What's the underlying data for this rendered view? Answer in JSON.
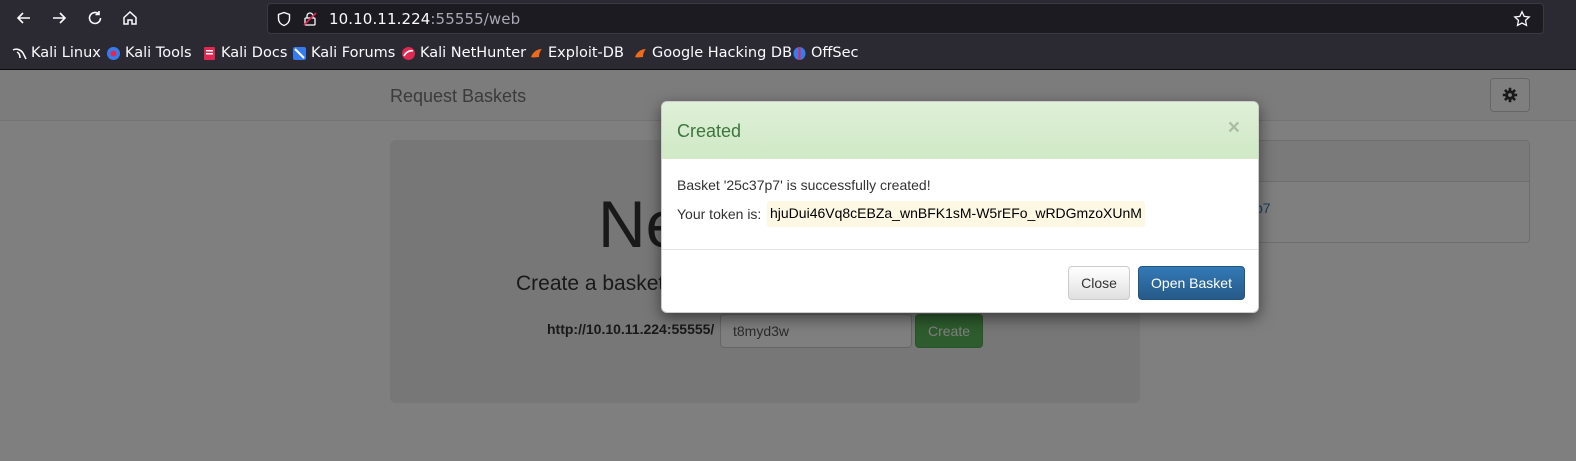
{
  "browser": {
    "url_host": "10.10.11.224",
    "url_rest": ":55555/web",
    "bookmarks": [
      {
        "label": "Kali Linux",
        "icon": "kali-dragon-icon"
      },
      {
        "label": "Kali Tools",
        "icon": "kali-tools-icon"
      },
      {
        "label": "Kali Docs",
        "icon": "kali-docs-icon"
      },
      {
        "label": "Kali Forums",
        "icon": "kali-forums-icon"
      },
      {
        "label": "Kali NetHunter",
        "icon": "kali-nethunter-icon"
      },
      {
        "label": "Exploit-DB",
        "icon": "exploit-db-icon"
      },
      {
        "label": "Google Hacking DB",
        "icon": "ghdb-icon"
      },
      {
        "label": "OffSec",
        "icon": "offsec-icon"
      }
    ]
  },
  "page": {
    "brand": "Request Baskets",
    "jumbo_title": "Ne",
    "jumbo_lead": "Create a basket",
    "url_prefix": "http://10.10.11.224:55555/",
    "basket_name_value": "t8myd3w",
    "create_label": "Create",
    "side_heading": ":",
    "side_link": "p7"
  },
  "modal": {
    "title": "Created",
    "close_x": "×",
    "message": "Basket '25c37p7' is successfully created!",
    "token_label": "Your token is:",
    "token": "hjuDui46Vq8cEBZa_wnBFK1sM-W5rEFo_wRDGmzoXUnM",
    "close_label": "Close",
    "open_label": "Open Basket"
  },
  "colors": {
    "browser_toolbar": "#2b2a33",
    "modal_header": "#dff0d8",
    "modal_title": "#3c763d",
    "primary": "#337ab7",
    "success": "#5cb85c",
    "token_bg": "#fcf8e3"
  }
}
